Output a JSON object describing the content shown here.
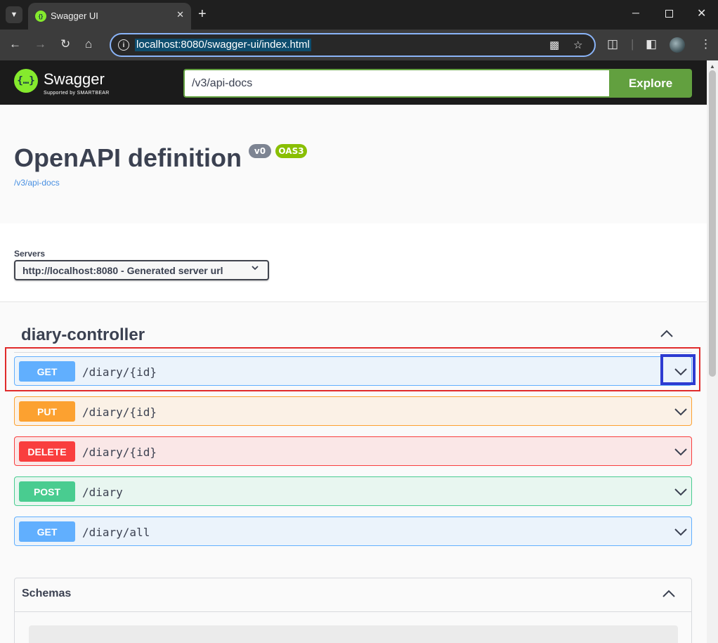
{
  "browser": {
    "tab_title": "Swagger UI",
    "new_tab": "+",
    "tab_close": "✕",
    "url": "localhost:8080/swagger-ui/index.html",
    "win_min": "─",
    "win_close": "✕"
  },
  "swagger": {
    "brand": "Swagger",
    "sub": "Supported by SMARTBEAR",
    "logo": "{…}",
    "url_value": "/v3/api-docs",
    "explore_label": "Explore"
  },
  "info": {
    "title": "OpenAPI definition",
    "version": "v0",
    "oas": "OAS3",
    "link": "/v3/api-docs"
  },
  "servers": {
    "label": "Servers",
    "selected": "http://localhost:8080 - Generated server url"
  },
  "tag": {
    "name": "diary-controller"
  },
  "operations": [
    {
      "method": "GET",
      "path": "/diary/{id}"
    },
    {
      "method": "PUT",
      "path": "/diary/{id}"
    },
    {
      "method": "DELETE",
      "path": "/diary/{id}"
    },
    {
      "method": "POST",
      "path": "/diary"
    },
    {
      "method": "GET",
      "path": "/diary/all"
    }
  ],
  "schemas": {
    "title": "Schemas"
  },
  "colors": {
    "get": "#61affe",
    "put": "#fca130",
    "delete": "#f93e3e",
    "post": "#49cc90",
    "swagger_green": "#62a03f"
  }
}
